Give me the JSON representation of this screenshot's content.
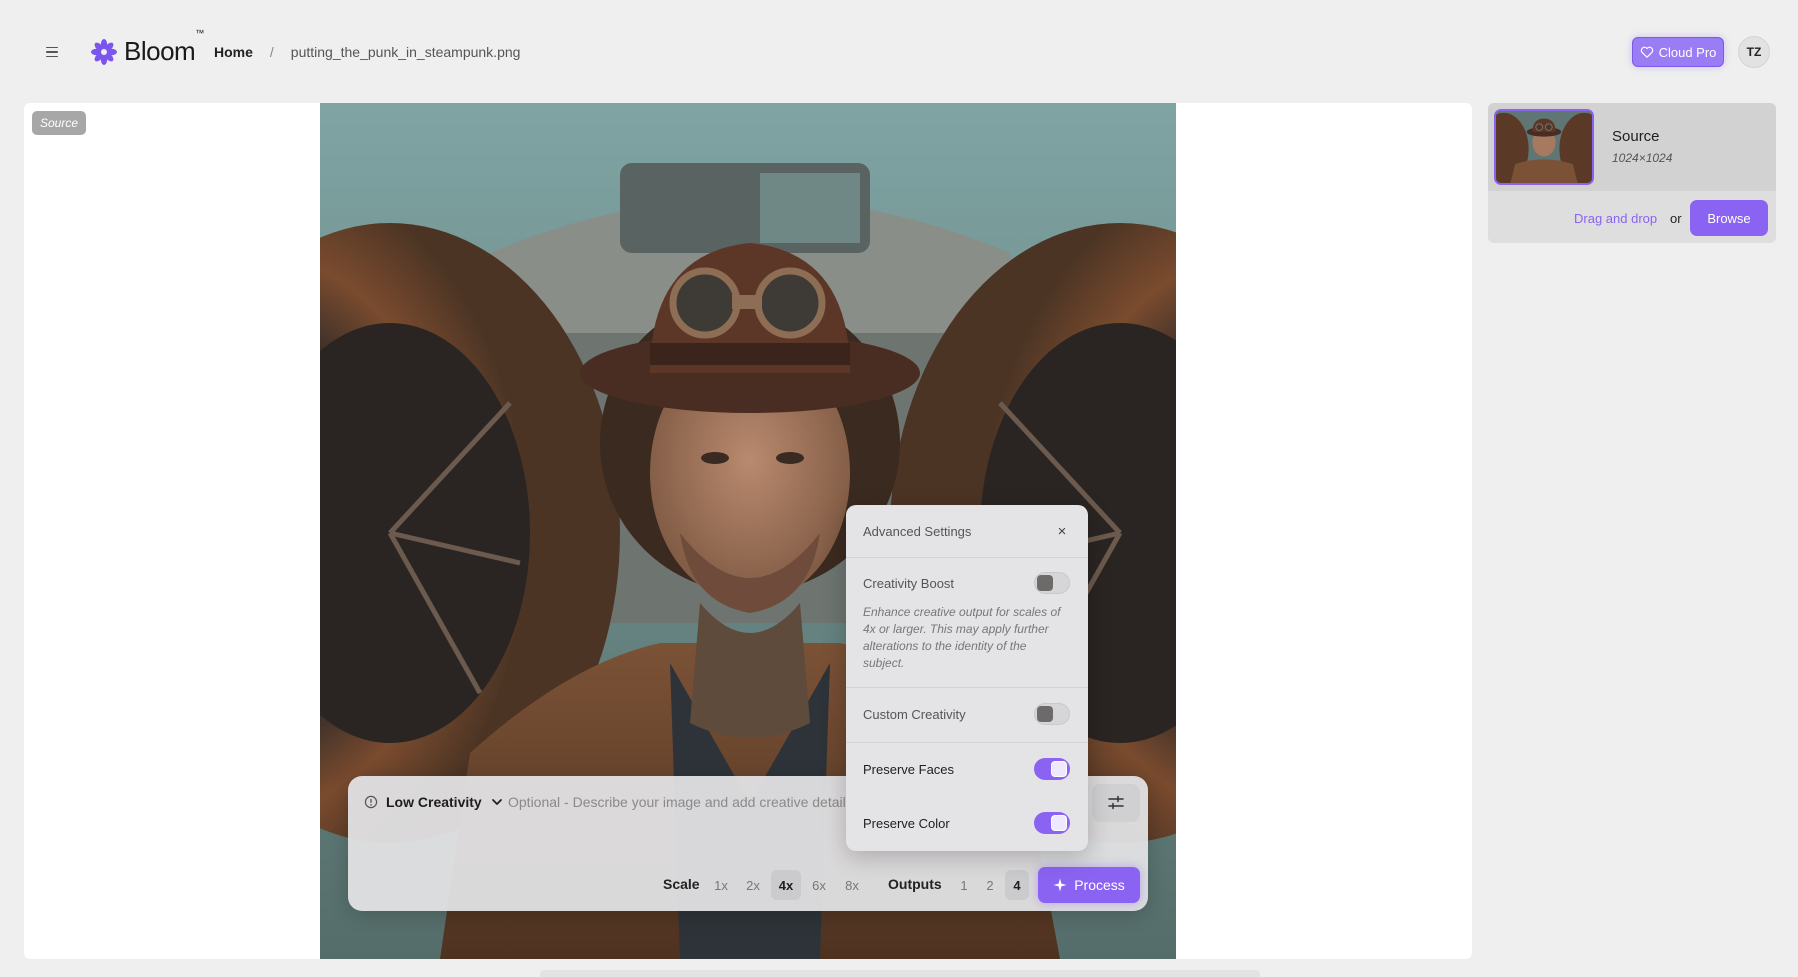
{
  "header": {
    "menu_icon": "hamburger-icon",
    "logo_text": "Bloom",
    "logo_tm": "™",
    "breadcrumb": {
      "home": "Home",
      "separator": "/",
      "file": "putting_the_punk_in_steampunk.png"
    },
    "cloud_pro_label": "Cloud Pro",
    "avatar_initials": "TZ"
  },
  "canvas": {
    "source_tag": "Source"
  },
  "prompt": {
    "creativity_label": "Low Creativity",
    "placeholder": "Optional - Describe your image and add creative details",
    "value": "",
    "scale_label": "Scale",
    "scales": [
      "1x",
      "2x",
      "4x",
      "6x",
      "8x"
    ],
    "scale_selected": "4x",
    "outputs_label": "Outputs",
    "outputs": [
      "1",
      "2",
      "4"
    ],
    "outputs_selected": "4",
    "process_label": "Process"
  },
  "advanced": {
    "title": "Advanced Settings",
    "close": "×",
    "creativity_boost": {
      "label": "Creativity Boost",
      "on": false,
      "description": "Enhance creative output for scales of 4x or larger. This may apply further alterations to the identity of the subject."
    },
    "custom_creativity": {
      "label": "Custom Creativity",
      "on": false
    },
    "preserve_faces": {
      "label": "Preserve Faces",
      "on": true
    },
    "preserve_color": {
      "label": "Preserve Color",
      "on": true
    }
  },
  "sidebar": {
    "title": "Source",
    "dimensions": "1024×1024",
    "drag_label": "Drag and drop",
    "or_label": "or",
    "browse_label": "Browse"
  },
  "colors": {
    "accent": "#8b63f2",
    "background": "#efefef",
    "panel": "#e4e4e6"
  }
}
